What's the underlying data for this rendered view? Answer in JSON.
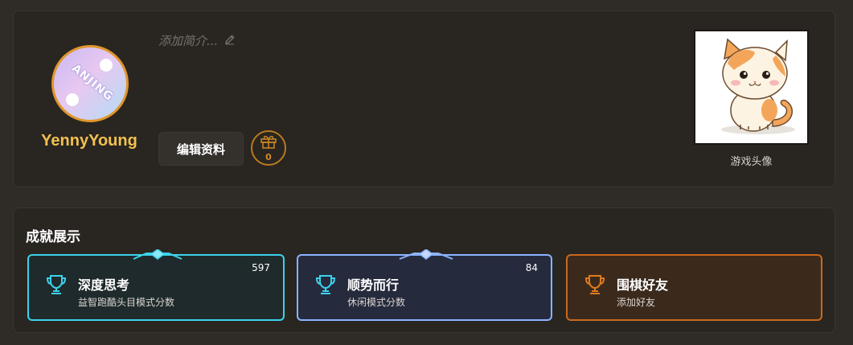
{
  "profile": {
    "avatar_text": "ANJING",
    "username": "YennyYoung",
    "bio_placeholder": "添加简介...",
    "edit_button": "编辑资料",
    "gift_count": "0",
    "game_avatar_label": "游戏头像"
  },
  "achievements": {
    "title": "成就展示",
    "badges": [
      {
        "title": "深度思考",
        "subtitle": "益智跑酷头目模式分数",
        "score": "597",
        "color": "#3cd2ec"
      },
      {
        "title": "顺势而行",
        "subtitle": "休闲模式分数",
        "score": "84",
        "color": "#8ab3ff"
      },
      {
        "title": "围棋好友",
        "subtitle": "添加好友",
        "score": "",
        "color": "#c9691e"
      }
    ]
  },
  "colors": {
    "accent": "#f2c14e",
    "gift": "#d08a24",
    "background": "#2f2b27"
  },
  "icons": [
    "edit-icon",
    "gift-icon",
    "trophy-icon"
  ]
}
